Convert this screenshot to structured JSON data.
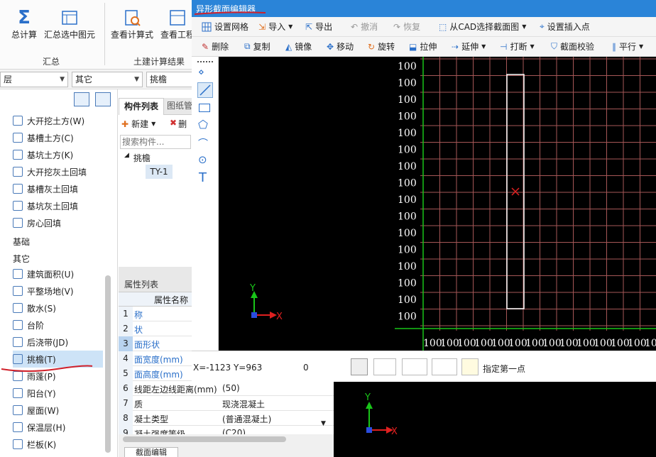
{
  "ribbon": {
    "buttons": [
      {
        "label": "总计算"
      },
      {
        "label": "汇总选中图元"
      },
      {
        "label": "查看计算式"
      },
      {
        "label": "查看工程"
      }
    ],
    "groups": {
      "summary": "汇总",
      "results": "土建计算结果"
    }
  },
  "filters": {
    "combo1": "层",
    "combo2": "其它",
    "combo3": "挑檐"
  },
  "left_tree": {
    "items": [
      {
        "label": "大开挖土方(W)"
      },
      {
        "label": "基槽土方(C)"
      },
      {
        "label": "基坑土方(K)"
      },
      {
        "label": "大开挖灰土回填"
      },
      {
        "label": "基槽灰土回填"
      },
      {
        "label": "基坑灰土回填"
      },
      {
        "label": "房心回填"
      }
    ],
    "heading_foundation": "基础",
    "heading_other": "其它",
    "other_items": [
      {
        "label": "建筑面积(U)"
      },
      {
        "label": "平整场地(V)"
      },
      {
        "label": "散水(S)"
      },
      {
        "label": "台阶"
      },
      {
        "label": "后浇带(JD)"
      },
      {
        "label": "挑檐(T)"
      },
      {
        "label": "雨蓬(P)"
      },
      {
        "label": "阳台(Y)"
      },
      {
        "label": "屋面(W)"
      },
      {
        "label": "保温层(H)"
      },
      {
        "label": "栏板(K)"
      }
    ]
  },
  "component_list": {
    "tab_active": "构件列表",
    "tab_other": "图纸管",
    "new_label": "新建",
    "delete_label": "删",
    "search_placeholder": "搜索构件...",
    "tree_parent": "挑檐",
    "tree_child": "TY-1"
  },
  "prop_list": {
    "title": "属性列表",
    "col_name": "属性名称",
    "rows": [
      {
        "no": "1",
        "name": "称",
        "value": ""
      },
      {
        "no": "2",
        "name": "状",
        "value": ""
      },
      {
        "no": "3",
        "name": "面形状",
        "value": ""
      },
      {
        "no": "4",
        "name": "面宽度(mm)",
        "value": ""
      },
      {
        "no": "5",
        "name": "面高度(mm)",
        "value": ""
      },
      {
        "no": "6",
        "name": "线距左边线距离(mm)",
        "value": "(50)"
      },
      {
        "no": "7",
        "name": "质",
        "value": "现浇混凝土"
      },
      {
        "no": "8",
        "name": "凝土类型",
        "value": "(普通混凝土)"
      },
      {
        "no": "9",
        "name": "凝土强度等级",
        "value": "(C20)"
      }
    ]
  },
  "bottom_tab": "截面编辑",
  "editor": {
    "title": "异形截面编辑器",
    "toolbar1": {
      "grid": "设置网格",
      "import": "导入",
      "export": "导出",
      "undo": "撤消",
      "redo": "恢复",
      "from_cad": "从CAD选择截面图",
      "insert_point": "设置插入点"
    },
    "toolbar2": {
      "delete": "删除",
      "copy": "复制",
      "mirror": "镜像",
      "move": "移动",
      "rotate": "旋转",
      "stretch": "拉伸",
      "extend": "延伸",
      "break": "打断",
      "check": "截面校验",
      "parallel": "平行"
    },
    "status": {
      "coords": "X=-1123 Y=963",
      "value": "0",
      "hint": "指定第一点"
    },
    "axis_x": "X",
    "axis_y": "Y",
    "grid_label": "100"
  },
  "colors": {
    "title_bar": "#2a84d8",
    "grid_line": "#a65757",
    "canvas": "#000000",
    "axis_x": "#e02020",
    "axis_y": "#19c419",
    "axis_base": "#2a4de0",
    "annotation": "#d0202a"
  }
}
